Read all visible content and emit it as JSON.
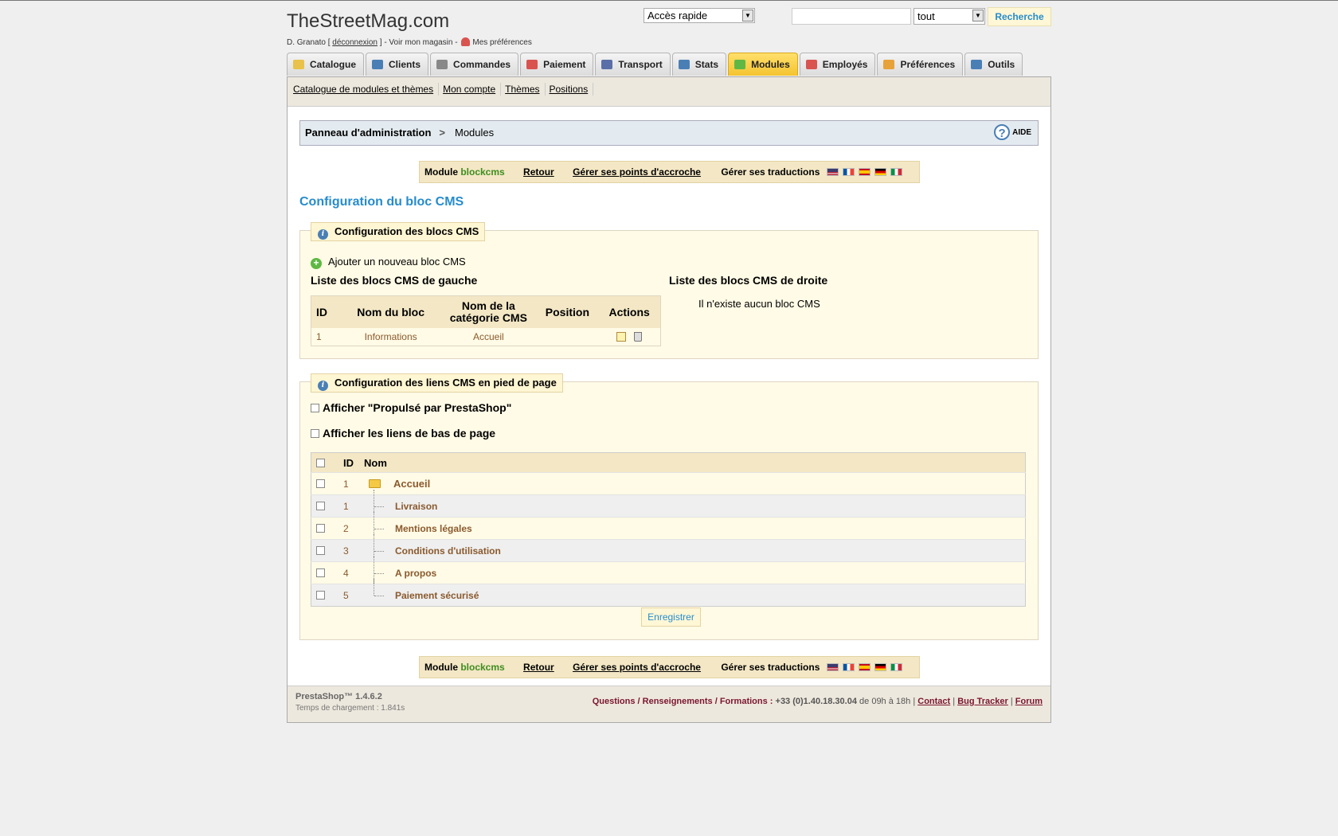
{
  "header": {
    "site_title": "TheStreetMag.com",
    "user_name": "D. Granato",
    "logout_prefix": "[",
    "logout_label": "déconnexion",
    "logout_suffix": "] - Voir mon magasin -",
    "preferences_label": "Mes préférences",
    "quick_access_value": "Accès rapide",
    "search_value": "",
    "search_scope_value": "tout",
    "search_button": "Recherche"
  },
  "tabs": [
    {
      "label": "Catalogue",
      "icon": "folder-icon",
      "color": "#e8c24a"
    },
    {
      "label": "Clients",
      "icon": "user-icon",
      "color": "#4a7fb5"
    },
    {
      "label": "Commandes",
      "icon": "cart-icon",
      "color": "#888888"
    },
    {
      "label": "Paiement",
      "icon": "payment-icon",
      "color": "#d9534f"
    },
    {
      "label": "Transport",
      "icon": "truck-icon",
      "color": "#5a6fa8"
    },
    {
      "label": "Stats",
      "icon": "chart-icon",
      "color": "#4a7fb5"
    },
    {
      "label": "Modules",
      "icon": "puzzle-icon",
      "color": "#5fb844",
      "active": true
    },
    {
      "label": "Employés",
      "icon": "employee-icon",
      "color": "#d9534f"
    },
    {
      "label": "Préférences",
      "icon": "preferences-icon",
      "color": "#e8a23a"
    },
    {
      "label": "Outils",
      "icon": "wrench-icon",
      "color": "#4a7fb5"
    }
  ],
  "subnav": [
    "Catalogue de modules et thèmes",
    "Mon compte",
    "Thèmes",
    "Positions"
  ],
  "breadcrumb": {
    "root": "Panneau d'administration",
    "separator": ">",
    "current": "Modules",
    "help": "AIDE",
    "help_glyph": "?"
  },
  "module_bar": {
    "module_prefix": "Module",
    "module_name": "blockcms",
    "back": "Retour",
    "hooks": "Gérer ses points d'accroche",
    "translations": "Gérer ses traductions",
    "flags": [
      "flag-en-icon",
      "flag-fr-icon",
      "flag-es-icon",
      "flag-de-icon",
      "flag-it-icon"
    ]
  },
  "config": {
    "title": "Configuration du bloc CMS",
    "blocks_legend": "Configuration des blocs CMS",
    "add_block": "Ajouter un nouveau bloc CMS",
    "add_glyph": "+",
    "info_glyph": "i",
    "left_heading": "Liste des blocs CMS de gauche",
    "right_heading": "Liste des blocs CMS de droite",
    "no_block": "Il n'existe aucun bloc CMS",
    "table_headers": [
      "ID",
      "Nom du bloc",
      "Nom de la catégorie CMS",
      "Position",
      "Actions"
    ],
    "left_blocks": [
      {
        "id": "1",
        "name": "Informations",
        "category": "Accueil",
        "position": ""
      }
    ]
  },
  "footer_links": {
    "legend": "Configuration des liens CMS en pied de page",
    "show_powered": "Afficher \"Propulsé par PrestaShop\"",
    "show_footer_links": "Afficher les liens de bas de page",
    "col_id": "ID",
    "col_name": "Nom",
    "root": {
      "id": "1",
      "name": "Accueil"
    },
    "pages": [
      {
        "id": "1",
        "name": "Livraison"
      },
      {
        "id": "2",
        "name": "Mentions légales"
      },
      {
        "id": "3",
        "name": "Conditions d'utilisation"
      },
      {
        "id": "4",
        "name": "A propos"
      },
      {
        "id": "5",
        "name": "Paiement sécurisé"
      }
    ],
    "save": "Enregistrer"
  },
  "footer": {
    "version": "PrestaShop™ 1.4.6.2",
    "load_time": "Temps de chargement : 1.841s",
    "questions": "Questions / Renseignements / Formations :",
    "phone": "+33 (0)1.40.18.30.04",
    "hours": "de 09h à 18h",
    "links": [
      "Contact",
      "Bug Tracker",
      "Forum"
    ]
  }
}
